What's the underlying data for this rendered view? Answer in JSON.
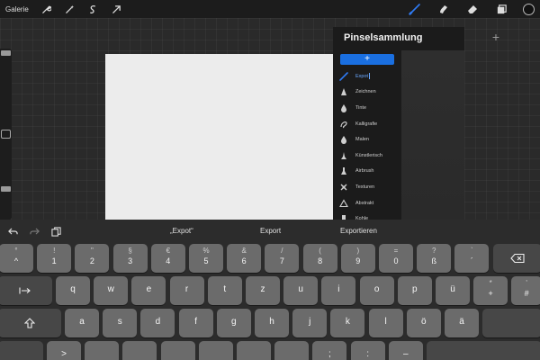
{
  "toolbar": {
    "gallery_label": "Galerie",
    "left_icons": [
      "wrench-icon",
      "magic-wand-icon",
      "selection-icon",
      "transform-arrow-icon"
    ],
    "right_icons": [
      "brush-icon",
      "smudge-icon",
      "eraser-icon",
      "layers-icon"
    ],
    "active_tool": "brush",
    "accent_color": "#2f7bf5"
  },
  "brush_library": {
    "title": "Pinselsammlung",
    "add_symbol": "+",
    "new_set_symbol": "+",
    "selected_index": 0,
    "items": [
      {
        "label": "Expot",
        "icon": "brush-stroke-icon"
      },
      {
        "label": "Zeichnen",
        "icon": "pencil-tip-icon"
      },
      {
        "label": "Tinte",
        "icon": "ink-drop-icon"
      },
      {
        "label": "Kalligrafie",
        "icon": "calligraphy-icon"
      },
      {
        "label": "Malen",
        "icon": "paint-drop-icon"
      },
      {
        "label": "Künstlerisch",
        "icon": "artistic-brush-icon"
      },
      {
        "label": "Airbrush",
        "icon": "airbrush-icon"
      },
      {
        "label": "Texturen",
        "icon": "texture-icon"
      },
      {
        "label": "Abstrakt",
        "icon": "triangle-icon"
      },
      {
        "label": "Kohle",
        "icon": "charcoal-icon"
      }
    ]
  },
  "keyboard": {
    "suggestions": [
      "„Expot“",
      "Export",
      "Exportieren"
    ],
    "row1": [
      {
        "top": "°",
        "main": "^"
      },
      {
        "top": "!",
        "main": "1"
      },
      {
        "top": "\"",
        "main": "2"
      },
      {
        "top": "§",
        "main": "3"
      },
      {
        "top": "€",
        "main": "4"
      },
      {
        "top": "%",
        "main": "5"
      },
      {
        "top": "&",
        "main": "6"
      },
      {
        "top": "/",
        "main": "7"
      },
      {
        "top": "(",
        "main": "8"
      },
      {
        "top": ")",
        "main": "9"
      },
      {
        "top": "=",
        "main": "0"
      },
      {
        "top": "?",
        "main": "ß"
      },
      {
        "top": "`",
        "main": "´"
      }
    ],
    "row2": [
      "q",
      "w",
      "e",
      "r",
      "t",
      "z",
      "u",
      "i",
      "o",
      "p",
      "ü"
    ],
    "row2_extra": [
      {
        "top": "*",
        "main": "+"
      },
      {
        "top": "'",
        "main": "#"
      }
    ],
    "row3": [
      "a",
      "s",
      "d",
      "f",
      "g",
      "h",
      "j",
      "k",
      "l",
      "ö",
      "ä"
    ],
    "row4_partial": [
      ">",
      "",
      "",
      "",
      "",
      "",
      "",
      ";",
      ":",
      "–"
    ]
  }
}
